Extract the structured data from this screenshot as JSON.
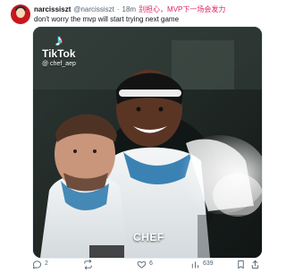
{
  "author": {
    "display_name": "narcissiszt",
    "handle": "@narcissiszt",
    "separator": "·",
    "time": "18m",
    "title": "别担心，MVP下一场会发力"
  },
  "post": {
    "text": "don't worry the mvp will start trying next game"
  },
  "media": {
    "tiktok_brand": "TikTok",
    "tiktok_handle": "@ chef_aep",
    "label": "CHEF"
  },
  "actions": {
    "reply_count": "2",
    "repost_count": "",
    "like_count": "6",
    "views_count": "639",
    "share_count": ""
  },
  "icons": {
    "avatar": "avatar-icon",
    "reply": "reply-icon",
    "repost": "repost-icon",
    "like": "like-icon",
    "views": "views-icon",
    "share": "share-icon"
  },
  "colors": {
    "text": "#0f1419",
    "muted": "#536471",
    "title_accent": "#e0245e",
    "tiktok_cyan": "#25f4ee",
    "tiktok_pink": "#fe2c55"
  }
}
